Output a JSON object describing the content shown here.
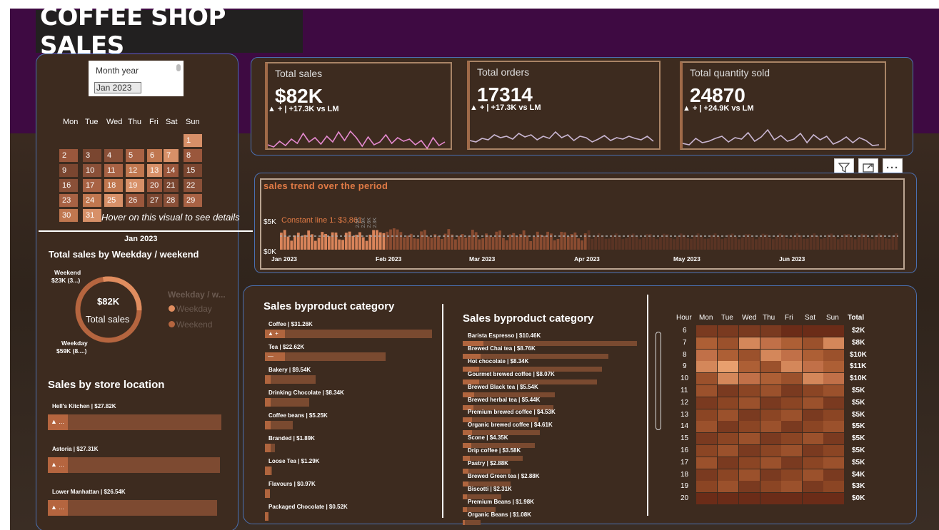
{
  "title": "COFFEE SHOP SALES",
  "slicer": {
    "label": "Month year",
    "value": "Jan 2023"
  },
  "calendar": {
    "days": [
      "Mon",
      "Tue",
      "Wed",
      "Thu",
      "Fri",
      "Sat",
      "Sun"
    ],
    "hover_note": "Hover on this visual to see details",
    "month_label": "Jan 2023",
    "dates": [
      "1",
      "2",
      "3",
      "4",
      "5",
      "6",
      "7",
      "8",
      "9",
      "10",
      "11",
      "12",
      "13",
      "14",
      "15",
      "16",
      "17",
      "18",
      "19",
      "20",
      "21",
      "22",
      "23",
      "24",
      "25",
      "26",
      "27",
      "28",
      "29",
      "30",
      "31"
    ]
  },
  "kpis": [
    {
      "title": "Total sales",
      "value": "$82K",
      "delta": "▲ + | +17.3K vs LM"
    },
    {
      "title": "Total orders",
      "value": "17314",
      "delta": "▲ + | +17.3K vs LM"
    },
    {
      "title": "Total quantity sold",
      "value": "24870",
      "delta": "▲ + | +24.9K vs LM"
    }
  ],
  "toolbar": {
    "filter_icon": "filter-icon",
    "focus_icon": "focus-mode-icon",
    "more_icon": "more-options-icon",
    "more_label": "···"
  },
  "trend": {
    "title": "sales trend over the period",
    "y_top": "$5K",
    "y_bottom": "$0K",
    "constant_line": "Constant line 1: $3,861",
    "x_labels": [
      "Jan 2023",
      "Feb 2023",
      "Mar 2023",
      "Apr 2023",
      "May 2023",
      "Jun 2023"
    ],
    "peak_labels": [
      "2.5K",
      "2.9K",
      "2.6K",
      "2.3K"
    ]
  },
  "weekday": {
    "title": "Total sales by Weekday / weekend",
    "center_value": "$82K",
    "center_label": "Total sales",
    "weekend_label": "Weekend",
    "weekend_value": "$23K (3...)",
    "weekday_label": "Weekday",
    "weekday_value": "$59K (8....)",
    "legend_title": "Weekday / w...",
    "legend": [
      "Weekday",
      "Weekend"
    ]
  },
  "store": {
    "title": "Sales by store location",
    "items": [
      {
        "label": "Hell's Kitchen | $27.82K",
        "badge": "▲ ..."
      },
      {
        "label": "Astoria | $27.31K",
        "badge": "▲ ..."
      },
      {
        "label": "Lower Manhattan | $26.54K",
        "badge": "▲ ..."
      }
    ]
  },
  "category": {
    "title": "Sales byproduct category",
    "items": [
      {
        "label": "Coffee | $31.26K",
        "badge": "▲ +",
        "value": 31.26
      },
      {
        "label": "Tea | $22.62K",
        "badge": "—",
        "value": 22.62
      },
      {
        "label": "Bakery | $9.54K",
        "value": 9.54
      },
      {
        "label": "Drinking Chocolate | $8.34K",
        "value": 8.34
      },
      {
        "label": "Coffee beans | $5.25K",
        "value": 5.25
      },
      {
        "label": "Branded | $1.89K",
        "value": 1.89
      },
      {
        "label": "Loose Tea | $1.29K",
        "value": 1.29
      },
      {
        "label": "Flavours | $0.97K",
        "value": 0.97
      },
      {
        "label": "Packaged Chocolate | $0.52K",
        "value": 0.52
      }
    ]
  },
  "product": {
    "title": "Sales byproduct category",
    "items": [
      {
        "label": "Barista Espresso | $10.46K",
        "value": 10.46
      },
      {
        "label": "Brewed Chai tea | $8.76K",
        "value": 8.76
      },
      {
        "label": "Hot chocolate | $8.34K",
        "value": 8.34
      },
      {
        "label": "Gourmet brewed coffee | $8.07K",
        "value": 8.07
      },
      {
        "label": "Brewed Black tea | $5.54K",
        "value": 5.54
      },
      {
        "label": "Brewed herbal tea | $5.44K",
        "value": 5.44
      },
      {
        "label": "Premium brewed coffee | $4.53K",
        "value": 4.53
      },
      {
        "label": "Organic brewed coffee | $4.61K",
        "value": 4.61
      },
      {
        "label": "Scone | $4.35K",
        "value": 4.35
      },
      {
        "label": "Drip coffee | $3.58K",
        "value": 3.58
      },
      {
        "label": "Pastry | $2.88K",
        "value": 2.88
      },
      {
        "label": "Brewed Green tea | $2.88K",
        "value": 2.88
      },
      {
        "label": "Biscotti | $2.31K",
        "value": 2.31
      },
      {
        "label": "Premium Beans | $1.98K",
        "value": 1.98
      },
      {
        "label": "Organic Beans | $1.08K",
        "value": 1.08
      }
    ]
  },
  "heatmap": {
    "columns": [
      "Hour",
      "Mon",
      "Tue",
      "Wed",
      "Thu",
      "Fri",
      "Sat",
      "Sun",
      "Total"
    ],
    "hours": [
      "6",
      "7",
      "8",
      "9",
      "10",
      "11",
      "12",
      "13",
      "14",
      "15",
      "16",
      "17",
      "18",
      "19",
      "20"
    ],
    "totals": [
      "$2K",
      "$8K",
      "$10K",
      "$11K",
      "$10K",
      "$5K",
      "$5K",
      "$5K",
      "$5K",
      "$5K",
      "$5K",
      "$5K",
      "$4K",
      "$3K",
      "$0K"
    ]
  },
  "colors": {
    "accent": "#b5653f",
    "purple": "#3e0a42",
    "panel": "#3d2b1f"
  }
}
